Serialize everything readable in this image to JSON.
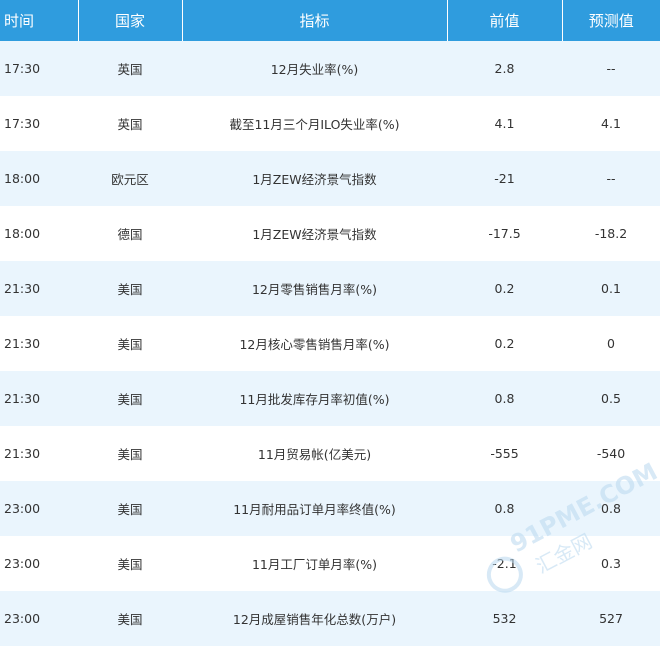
{
  "table": {
    "headers": {
      "time": "时间",
      "country": "国家",
      "indicator": "指标",
      "previous": "前值",
      "forecast": "预测值"
    },
    "rows": [
      {
        "time": "17:30",
        "country": "英国",
        "indicator": "12月失业率(%)",
        "previous": "2.8",
        "forecast": "--"
      },
      {
        "time": "17:30",
        "country": "英国",
        "indicator": "截至11月三个月ILO失业率(%)",
        "previous": "4.1",
        "forecast": "4.1"
      },
      {
        "time": "18:00",
        "country": "欧元区",
        "indicator": "1月ZEW经济景气指数",
        "previous": "-21",
        "forecast": "--"
      },
      {
        "time": "18:00",
        "country": "德国",
        "indicator": "1月ZEW经济景气指数",
        "previous": "-17.5",
        "forecast": "-18.2"
      },
      {
        "time": "21:30",
        "country": "美国",
        "indicator": "12月零售销售月率(%)",
        "previous": "0.2",
        "forecast": "0.1"
      },
      {
        "time": "21:30",
        "country": "美国",
        "indicator": "12月核心零售销售月率(%)",
        "previous": "0.2",
        "forecast": "0"
      },
      {
        "time": "21:30",
        "country": "美国",
        "indicator": "11月批发库存月率初值(%)",
        "previous": "0.8",
        "forecast": "0.5"
      },
      {
        "time": "21:30",
        "country": "美国",
        "indicator": "11月贸易帐(亿美元)",
        "previous": "-555",
        "forecast": "-540"
      },
      {
        "time": "23:00",
        "country": "美国",
        "indicator": "11月耐用品订单月率终值(%)",
        "previous": "0.8",
        "forecast": "0.8"
      },
      {
        "time": "23:00",
        "country": "美国",
        "indicator": "11月工厂订单月率(%)",
        "previous": "-2.1",
        "forecast": "0.3"
      },
      {
        "time": "23:00",
        "country": "美国",
        "indicator": "12月成屋销售年化总数(万户)",
        "previous": "532",
        "forecast": "527"
      }
    ]
  },
  "watermark": {
    "text_latin": "91PME.COM",
    "text_cn": "汇金网",
    "color": "#b9d8ef"
  }
}
